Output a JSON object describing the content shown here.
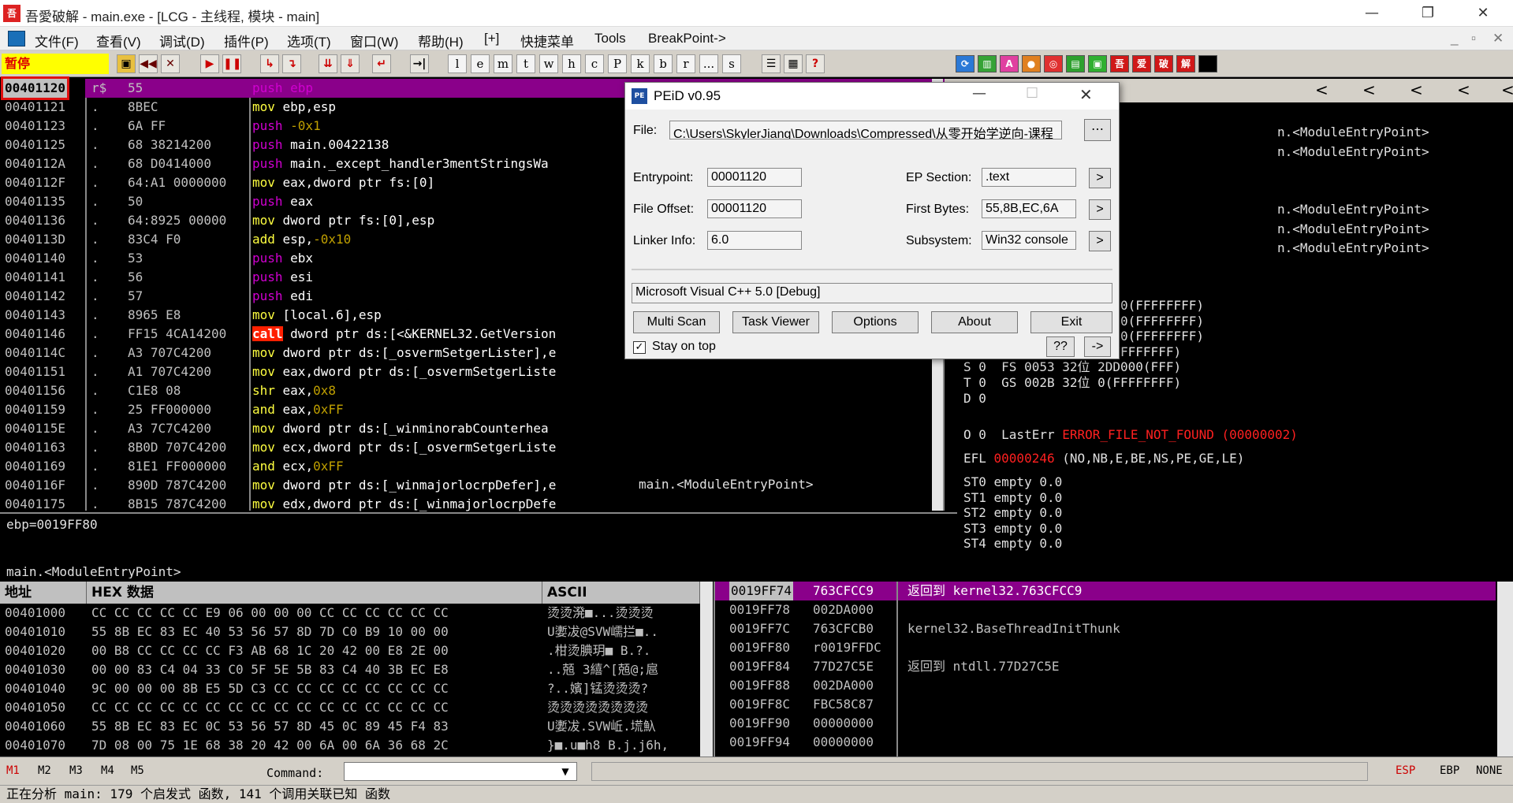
{
  "window": {
    "title": "吾愛破解 - main.exe - [LCG - 主线程, 模块 - main]",
    "icon_text": "吾",
    "minimize": "—",
    "restore": "❐",
    "close": "✕"
  },
  "menu": {
    "items": [
      "文件(F)",
      "查看(V)",
      "调试(D)",
      "插件(P)",
      "选项(T)",
      "窗口(W)",
      "帮助(H)",
      "[+]",
      "快捷菜单",
      "Tools",
      "BreakPoint->"
    ],
    "mdi_min": "_",
    "mdi_restore": "▫",
    "mdi_close": "✕"
  },
  "toolbar": {
    "status": "暂停",
    "letters": [
      "l",
      "e",
      "m",
      "t",
      "w",
      "h",
      "c",
      "P",
      "k",
      "b",
      "r",
      "...",
      "s"
    ],
    "cn_buttons": [
      "吾",
      "爱",
      "破",
      "解"
    ]
  },
  "cpu": {
    "rows": [
      {
        "addr": "00401120",
        "mark": "r$",
        "hex": "55",
        "asm": [
          [
            "push",
            "p"
          ],
          [
            " ebp",
            "w"
          ]
        ],
        "hl": true
      },
      {
        "addr": "00401121",
        "mark": ".",
        "hex": "8BEC",
        "asm": [
          [
            "mov",
            "y"
          ],
          [
            " ebp,esp",
            "w"
          ]
        ]
      },
      {
        "addr": "00401123",
        "mark": ".",
        "hex": "6A FF",
        "asm": [
          [
            "push",
            "p"
          ],
          [
            " -0x1",
            "o"
          ]
        ]
      },
      {
        "addr": "00401125",
        "mark": ".",
        "hex": "68 38214200",
        "asm": [
          [
            "push",
            "p"
          ],
          [
            " main.00422138",
            "w"
          ]
        ]
      },
      {
        "addr": "0040112A",
        "mark": ".",
        "hex": "68 D0414000",
        "asm": [
          [
            "push",
            "p"
          ],
          [
            " main._except_handler3mentStringsWa",
            "w"
          ]
        ]
      },
      {
        "addr": "0040112F",
        "mark": ".",
        "hex": "64:A1 0000000",
        "asm": [
          [
            "mov",
            "y"
          ],
          [
            " eax,dword ptr fs:[0]",
            "w"
          ]
        ]
      },
      {
        "addr": "00401135",
        "mark": ".",
        "hex": "50",
        "asm": [
          [
            "push",
            "p"
          ],
          [
            " eax",
            "w"
          ]
        ]
      },
      {
        "addr": "00401136",
        "mark": ".",
        "hex": "64:8925 00000",
        "asm": [
          [
            "mov",
            "y"
          ],
          [
            " dword ptr fs:[0],esp",
            "w"
          ]
        ]
      },
      {
        "addr": "0040113D",
        "mark": ".",
        "hex": "83C4 F0",
        "asm": [
          [
            "add",
            "y"
          ],
          [
            " esp,",
            "w"
          ],
          [
            "-0x10",
            "o"
          ]
        ]
      },
      {
        "addr": "00401140",
        "mark": ".",
        "hex": "53",
        "asm": [
          [
            "push",
            "p"
          ],
          [
            " ebx",
            "w"
          ]
        ]
      },
      {
        "addr": "00401141",
        "mark": ".",
        "hex": "56",
        "asm": [
          [
            "push",
            "p"
          ],
          [
            " esi",
            "w"
          ]
        ]
      },
      {
        "addr": "00401142",
        "mark": ".",
        "hex": "57",
        "asm": [
          [
            "push",
            "p"
          ],
          [
            " edi",
            "w"
          ]
        ]
      },
      {
        "addr": "00401143",
        "mark": ".",
        "hex": "8965 E8",
        "asm": [
          [
            "mov",
            "y"
          ],
          [
            " [local.6],esp",
            "w"
          ]
        ]
      },
      {
        "addr": "00401146",
        "mark": ".",
        "hex": "FF15 4CA14200",
        "asm": [
          [
            "call",
            "c"
          ],
          [
            " dword ptr ds:[<&KERNEL32.GetVersion",
            "w"
          ]
        ]
      },
      {
        "addr": "0040114C",
        "mark": ".",
        "hex": "A3 707C4200",
        "asm": [
          [
            "mov",
            "y"
          ],
          [
            " dword ptr ds:[_osvermSetgerLister],e",
            "w"
          ]
        ]
      },
      {
        "addr": "00401151",
        "mark": ".",
        "hex": "A1 707C4200",
        "asm": [
          [
            "mov",
            "y"
          ],
          [
            " eax,dword ptr ds:[_osvermSetgerListe",
            "w"
          ]
        ]
      },
      {
        "addr": "00401156",
        "mark": ".",
        "hex": "C1E8 08",
        "asm": [
          [
            "shr",
            "y"
          ],
          [
            " eax,",
            "w"
          ],
          [
            "0x8",
            "o"
          ]
        ]
      },
      {
        "addr": "00401159",
        "mark": ".",
        "hex": "25 FF000000",
        "asm": [
          [
            "and",
            "y"
          ],
          [
            " eax,",
            "w"
          ],
          [
            "0xFF",
            "o"
          ]
        ]
      },
      {
        "addr": "0040115E",
        "mark": ".",
        "hex": "A3 7C7C4200",
        "asm": [
          [
            "mov",
            "y"
          ],
          [
            " dword ptr ds:[_winminorabCounterhea",
            "w"
          ]
        ]
      },
      {
        "addr": "00401163",
        "mark": ".",
        "hex": "8B0D 707C4200",
        "asm": [
          [
            "mov",
            "y"
          ],
          [
            " ecx,dword ptr ds:[_osvermSetgerListe",
            "w"
          ]
        ]
      },
      {
        "addr": "00401169",
        "mark": ".",
        "hex": "81E1 FF000000",
        "asm": [
          [
            "and",
            "y"
          ],
          [
            " ecx,",
            "w"
          ],
          [
            "0xFF",
            "o"
          ]
        ]
      },
      {
        "addr": "0040116F",
        "mark": ".",
        "hex": "890D 787C4200",
        "asm": [
          [
            "mov",
            "y"
          ],
          [
            " dword ptr ds:[_winmajorlocrpDefer],e",
            "w"
          ]
        ]
      },
      {
        "addr": "00401175",
        "mark": ".",
        "hex": "8B15 787C4200",
        "asm": [
          [
            "mov",
            "y"
          ],
          [
            " edx,dword ptr ds:[_winmajorlocrpDefe",
            "w"
          ]
        ]
      }
    ],
    "comment": "main.<ModuleEntryPoint>"
  },
  "regs": {
    "entry_rows": [
      "n.<ModuleEntryPoint>",
      "n.<ModuleEntryPoint>",
      "",
      "",
      "n.<ModuleEntryPoint>",
      "n.<ModuleEntryPoint>",
      "n.<ModuleEntryPoint>"
    ],
    "seg_rows": [
      "                  立 0(FFFFFFFF)",
      "                  立 0(FFFFFFFF)",
      "                  立 0(FFFFFFFF)",
      "E    DS 002B 32位 0(FFFFFFFF)",
      "S 0  FS 0053 32位 2DD000(FFF)",
      "T 0  GS 002B 32位 0(FFFFFFFF)",
      "D 0"
    ],
    "lasterr_prefix": "O 0  LastErr ",
    "lasterr_value": "ERROR_FILE_NOT_FOUND (00000002)",
    "efl_prefix": "EFL ",
    "efl_value": "00000246",
    "efl_flags": " (NO,NB,E,BE,NS,PE,GE,LE)",
    "fpu": [
      "ST0 empty 0.0",
      "ST1 empty 0.0",
      "ST2 empty 0.0",
      "ST3 empty 0.0",
      "ST4 empty 0.0"
    ],
    "nav_arrows": [
      "<",
      "<",
      "<",
      "<",
      "<"
    ]
  },
  "info": {
    "line1": "ebp=0019FF80",
    "line2": "main.<ModuleEntryPoint>"
  },
  "dump": {
    "col_addr": "地址",
    "col_hex": "HEX 数据",
    "col_ascii": "ASCII",
    "rows": [
      {
        "addr": "00401000",
        "hex": "CC CC CC CC CC E9 06 00 00 00 CC CC CC CC CC CC",
        "ascii": "烫烫溌■...烫烫烫"
      },
      {
        "addr": "00401010",
        "hex": "55 8B EC 83 EC 40 53 56 57 8D 7D C0 B9 10 00 00",
        "ascii": "U嬱冹@SVW嶿拦■.."
      },
      {
        "addr": "00401020",
        "hex": "00 B8 CC CC CC CC F3 AB 68 1C 20 42 00 E8 2E 00",
        "ascii": ".柑烫腆玥■ B.?."
      },
      {
        "addr": "00401030",
        "hex": "00 00 83 C4 04 33 C0 5F 5E 5B 83 C4 40 3B EC E8",
        "ascii": "..兡 3繥^[兡@;扈"
      },
      {
        "addr": "00401040",
        "hex": "9C 00 00 00 8B E5 5D C3 CC CC CC CC CC CC CC CC",
        "ascii": "?..嬪]锰烫烫烫?"
      },
      {
        "addr": "00401050",
        "hex": "CC CC CC CC CC CC CC CC CC CC CC CC CC CC CC CC",
        "ascii": "烫烫烫烫烫烫烫烫"
      },
      {
        "addr": "00401060",
        "hex": "55 8B EC 83 EC 0C 53 56 57 8D 45 0C 89 45 F4 83",
        "ascii": "U嬱冹.SVW岴.塃魞"
      },
      {
        "addr": "00401070",
        "hex": "7D 08 00 75 1E 68 38 20 42 00 6A 00 6A 36 68 2C",
        "ascii": "}■.u■h8 B.j.j6h,"
      }
    ]
  },
  "stack": {
    "rows": [
      {
        "addr": "0019FF74",
        "val": "763CFCC9",
        "comment": "返回到 kernel32.763CFCC9",
        "hl": true
      },
      {
        "addr": "0019FF78",
        "val": "002DA000",
        "comment": ""
      },
      {
        "addr": "0019FF7C",
        "val": "763CFCB0",
        "comment": "kernel32.BaseThreadInitThunk"
      },
      {
        "addr": "0019FF80",
        "val": "r0019FFDC",
        "comment": ""
      },
      {
        "addr": "0019FF84",
        "val": "77D27C5E",
        "comment": "返回到 ntdll.77D27C5E"
      },
      {
        "addr": "0019FF88",
        "val": "002DA000",
        "comment": ""
      },
      {
        "addr": "0019FF8C",
        "val": "FBC58C87",
        "comment": ""
      },
      {
        "addr": "0019FF90",
        "val": "00000000",
        "comment": ""
      },
      {
        "addr": "0019FF94",
        "val": "00000000",
        "comment": ""
      }
    ]
  },
  "cmdbar": {
    "marks": [
      "M1",
      "M2",
      "M3",
      "M4",
      "M5"
    ],
    "command_label": "Command:",
    "command_value": "",
    "regs": [
      "ESP",
      "EBP",
      "NONE"
    ]
  },
  "statusbar": {
    "text": "正在分析 main: 179 个启发式 函数, 141 个调用关联已知 函数"
  },
  "peid": {
    "title": "PEiD v0.95",
    "logo": "PE",
    "file_label": "File:",
    "file_value": "C:\\Users\\SkylerJiang\\Downloads\\Compressed\\从零开始学逆向-课程",
    "entrypoint_label": "Entrypoint:",
    "entrypoint_value": "00001120",
    "fileoffset_label": "File Offset:",
    "fileoffset_value": "00001120",
    "linker_label": "Linker Info:",
    "linker_value": "6.0",
    "epsection_label": "EP Section:",
    "epsection_value": ".text",
    "firstbytes_label": "First Bytes:",
    "firstbytes_value": "55,8B,EC,6A",
    "subsystem_label": "Subsystem:",
    "subsystem_value": "Win32 console",
    "detected": "Microsoft Visual C++ 5.0 [Debug]",
    "btn_multiscan": "Multi Scan",
    "btn_taskviewer": "Task Viewer",
    "btn_options": "Options",
    "btn_about": "About",
    "btn_exit": "Exit",
    "stay_on_top": "Stay on top",
    "btn_help": "??",
    "btn_ext": "->",
    "small_arrow": ">"
  },
  "colors": {
    "highlight_purple": "#8a008a",
    "paused_yellow": "#ffff00",
    "red_mark": "#e01010"
  }
}
